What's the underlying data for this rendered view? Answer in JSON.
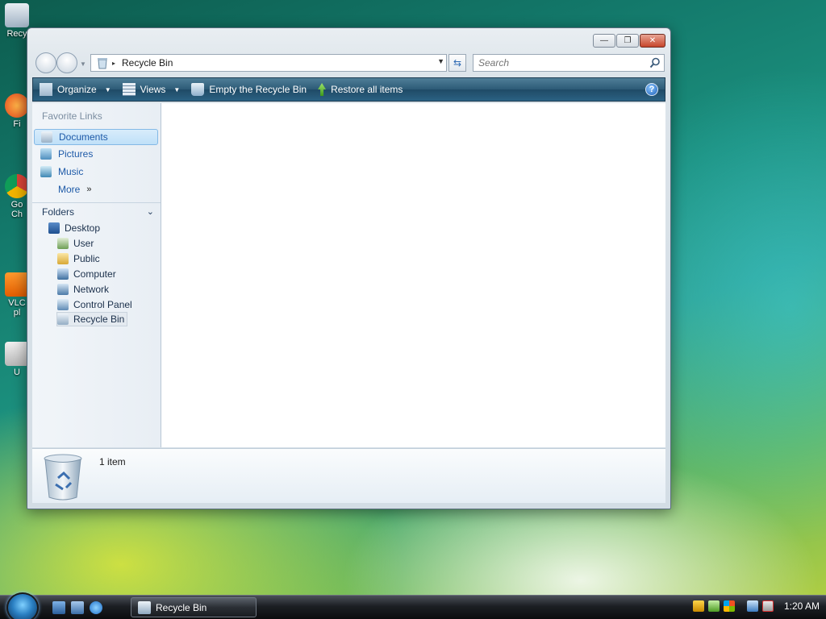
{
  "desktop": {
    "icons": [
      {
        "name": "recycle-bin-desktop",
        "label": "Recy"
      },
      {
        "name": "firefox-desktop",
        "label": "Fi"
      },
      {
        "name": "chrome-desktop",
        "label": "Go\nCh"
      },
      {
        "name": "vlc-desktop",
        "label": "VLC\npl"
      },
      {
        "name": "unknown-desktop",
        "label": "U"
      }
    ]
  },
  "window": {
    "title_buttons": {
      "minimize": "—",
      "maximize": "❐",
      "close": "✕"
    },
    "address": {
      "breadcrumb_separator": "▸",
      "location": "Recycle Bin"
    },
    "search": {
      "placeholder": "Search"
    },
    "toolbar": {
      "organize": "Organize",
      "views": "Views",
      "empty_bin": "Empty the Recycle Bin",
      "restore_all": "Restore all items",
      "help": "?"
    },
    "nav_pane": {
      "favorite_links_heading": "Favorite Links",
      "favorite_links": [
        "Documents",
        "Pictures",
        "Music"
      ],
      "more": "More",
      "folders_heading": "Folders",
      "folders": [
        "Desktop",
        "User",
        "Public",
        "Computer",
        "Network",
        "Control Panel",
        "Recycle Bin"
      ]
    },
    "details": {
      "item_count": "1 item"
    }
  },
  "taskbar": {
    "active_task": "Recycle Bin",
    "clock": "1:20 AM"
  },
  "colors": {
    "command_bar": "#2c5a76",
    "link": "#1e5aa8",
    "selection": "#bfe0f8"
  }
}
